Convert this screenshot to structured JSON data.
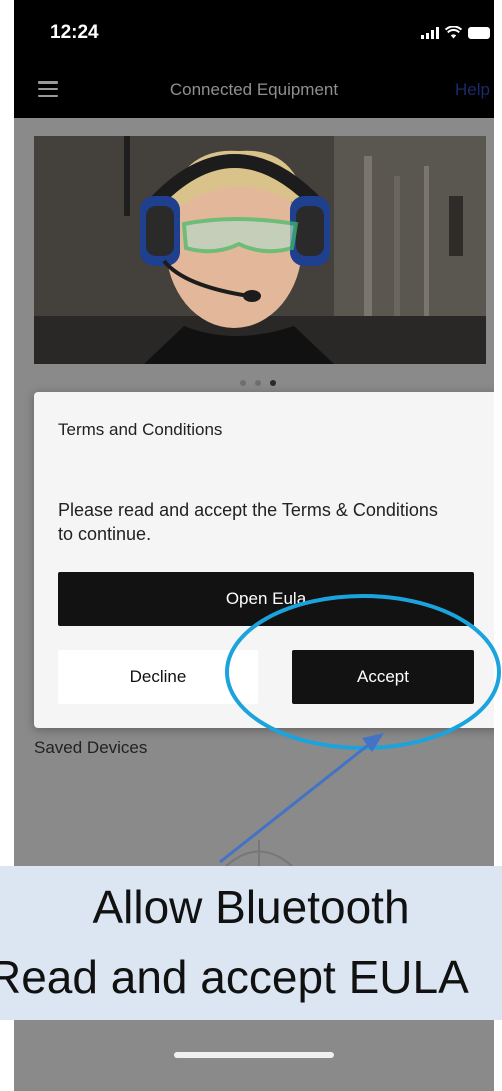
{
  "status_bar": {
    "time": "12:24",
    "signal_icon": "cellular-signal-icon",
    "wifi_icon": "wifi-icon",
    "battery_icon": "battery-icon"
  },
  "nav": {
    "menu_icon": "hamburger-menu-icon",
    "title": "Connected Equipment",
    "help": "Help"
  },
  "carousel": {
    "image": "worker-with-headset-photo",
    "page_count": 3,
    "active_page": 3
  },
  "dialog": {
    "title": "Terms and Conditions",
    "message": "Please read and accept the Terms & Conditions to continue.",
    "open_eula_label": "Open Eula",
    "decline_label": "Decline",
    "accept_label": "Accept"
  },
  "saved_devices_label": "Saved Devices",
  "annotation": {
    "caption_line1": "Allow Bluetooth",
    "caption_line2": "Read and accept EULA",
    "highlight_color": "#1aa3dc",
    "arrow_color": "#4472c4",
    "caption_bg": "#dce6f2"
  },
  "colors": {
    "nav_bg": "#000000",
    "help_color": "#1a2a6a",
    "button_dark": "#121212",
    "overlay_gray": "#8a8a8a"
  }
}
